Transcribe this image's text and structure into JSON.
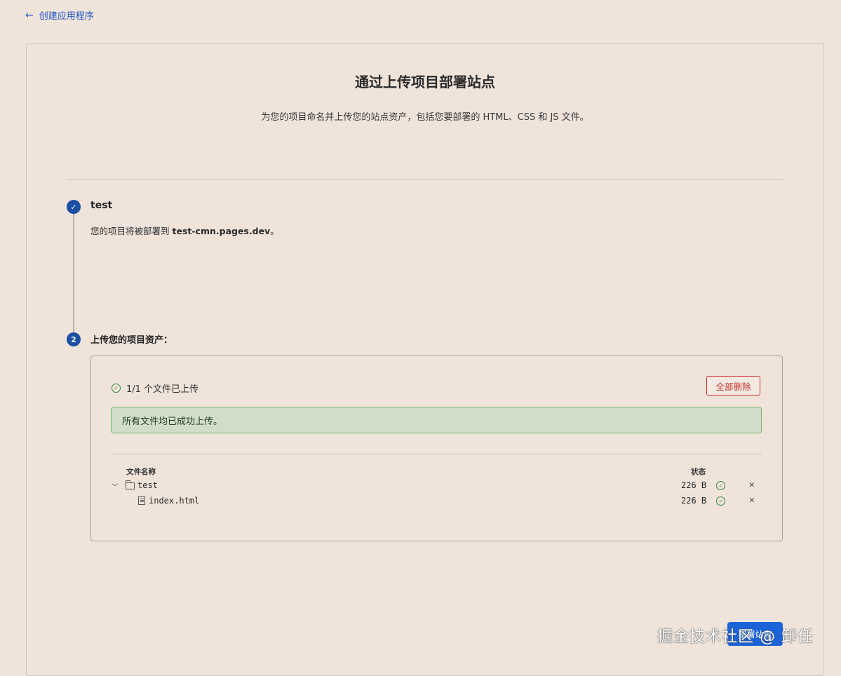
{
  "nav": {
    "back_label": "创建应用程序"
  },
  "header": {
    "title": "通过上传项目部署站点",
    "subtitle": "为您的项目命名并上传您的站点资产，包括您要部署的 HTML、CSS 和 JS 文件。"
  },
  "step1": {
    "title": "test",
    "desc_prefix": "您的项目将被部署到 ",
    "domain": "test-cmn.pages.dev",
    "desc_suffix": "。"
  },
  "step2": {
    "number": "2",
    "title": "上传您的项目资产："
  },
  "upload": {
    "status_text": "1/1 个文件已上传",
    "delete_all_label": "全部删除",
    "success_message": "所有文件均已成功上传。",
    "columns": {
      "name": "文件名称",
      "status": "状态"
    },
    "files": [
      {
        "name": "test",
        "size": "226 B",
        "type": "folder"
      },
      {
        "name": "index.html",
        "size": "226 B",
        "type": "file"
      }
    ]
  },
  "footer": {
    "deploy_label": "部署站点",
    "watermark": "掘金技术社区 @ 卸任"
  },
  "colors": {
    "accent": "#1a4fa3",
    "danger": "#c9302c",
    "success": "#2f8a3e",
    "background": "#efe3da"
  }
}
